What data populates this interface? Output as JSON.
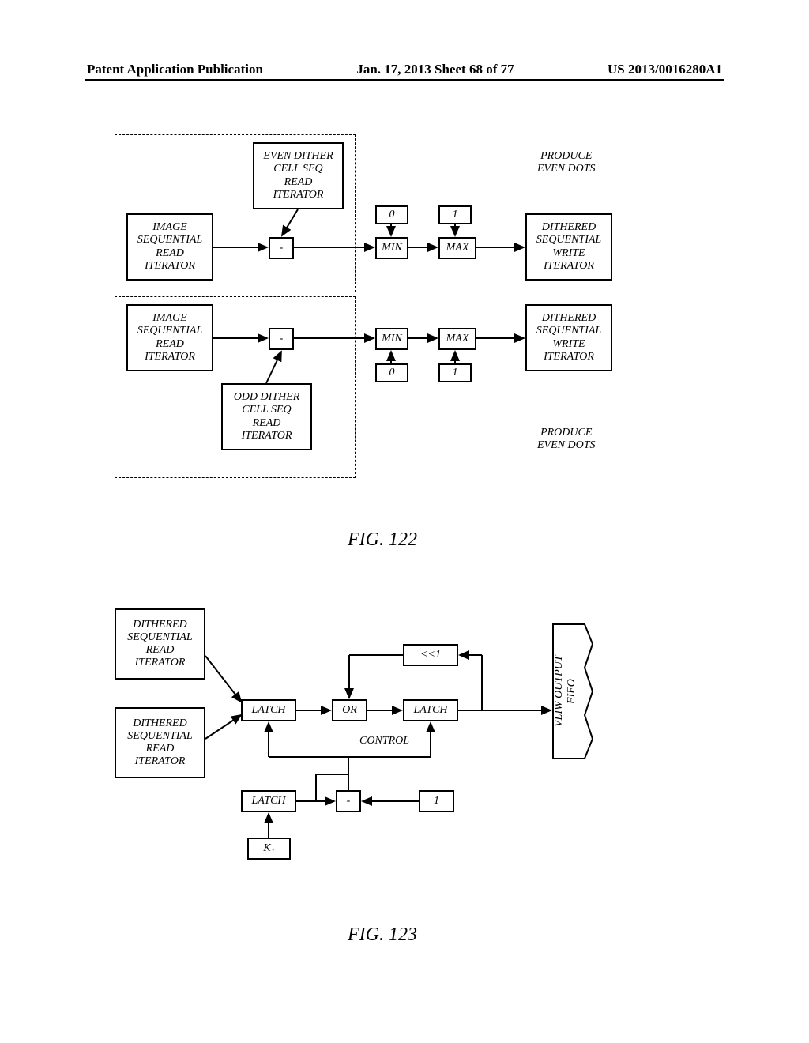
{
  "header": {
    "left": "Patent Application Publication",
    "mid": "Jan. 17, 2013  Sheet 68 of 77",
    "right": "US 2013/0016280A1"
  },
  "fig122": {
    "caption": "FIG. 122",
    "label_top": "PRODUCE\nEVEN DOTS",
    "label_bot": "PRODUCE\nEVEN DOTS",
    "even_dither": "EVEN DITHER\nCELL SEQ\nREAD\nITERATOR",
    "odd_dither": "ODD DITHER\nCELL SEQ\nREAD\nITERATOR",
    "img_iter": "IMAGE\nSEQUENTIAL\nREAD\nITERATOR",
    "dithered_write": "DITHERED\nSEQUENTIAL\nWRITE\nITERATOR",
    "sub": "-",
    "min": "MIN",
    "max": "MAX",
    "zero": "0",
    "one": "1"
  },
  "fig123": {
    "caption": "FIG. 123",
    "dithered_read": "DITHERED\nSEQUENTIAL\nREAD\nITERATOR",
    "latch": "LATCH",
    "or": "OR",
    "shl": "<<1",
    "control": "CONTROL",
    "sub": "-",
    "one": "1",
    "k1": "K₁",
    "fifo": "VLIW OUTPUT\nFIFO"
  }
}
